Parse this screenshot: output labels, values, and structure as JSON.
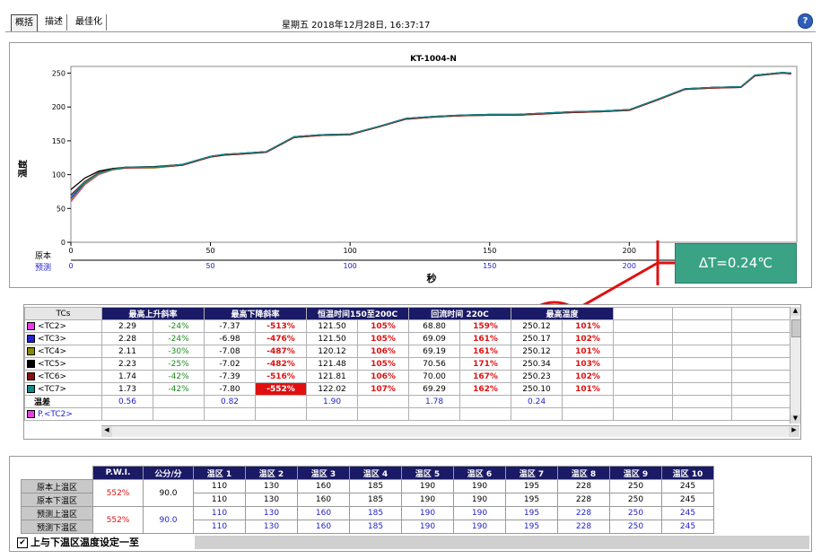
{
  "tabs": [
    {
      "label": "概括",
      "active": true
    },
    {
      "label": "描述",
      "active": false
    },
    {
      "label": "最佳化",
      "active": false
    }
  ],
  "datetime": "星期五 2018年12月28日, 16:37:17",
  "help_label": "?",
  "chart": {
    "title": "KT-1004-N",
    "ylabel": "温度",
    "xlabel": "秒",
    "row_labels": [
      "原本",
      "预测"
    ],
    "x_ticks": [
      "0",
      "50",
      "100",
      "150",
      "200"
    ],
    "y_ticks": [
      "0",
      "50",
      "100",
      "150",
      "200",
      "250"
    ],
    "delta_label": "ΔT=0.24℃"
  },
  "chart_data": {
    "type": "line",
    "title": "KT-1004-N",
    "xlabel": "秒",
    "ylabel": "温度",
    "xlim": [
      0,
      260
    ],
    "ylim": [
      0,
      260
    ],
    "series": [
      {
        "color": "#e83ce8",
        "x": [
          0,
          5,
          10,
          15,
          20,
          30,
          40,
          50,
          55,
          60,
          70,
          80,
          90,
          100,
          110,
          120,
          130,
          140,
          150,
          160,
          170,
          180,
          190,
          200,
          210,
          220,
          230,
          240,
          245,
          250,
          255,
          258
        ],
        "y": [
          60,
          85,
          100,
          107,
          110,
          110,
          114,
          126,
          129,
          130,
          133,
          155,
          158,
          159,
          170,
          182,
          185,
          187,
          188,
          188,
          190,
          192,
          193,
          195,
          210,
          226,
          228,
          229,
          246,
          248,
          250,
          249
        ]
      },
      {
        "color": "#2222cc",
        "x": [
          0,
          5,
          10,
          15,
          20,
          30,
          40,
          50,
          55,
          60,
          70,
          80,
          90,
          100,
          110,
          120,
          130,
          140,
          150,
          160,
          170,
          180,
          190,
          200,
          210,
          220,
          230,
          240,
          245,
          250,
          255,
          258
        ],
        "y": [
          65,
          88,
          102,
          108,
          111,
          111,
          115,
          127,
          130,
          131,
          134,
          156,
          159,
          160,
          171,
          183,
          186,
          188,
          189,
          189,
          191,
          193,
          194,
          196,
          211,
          227,
          229,
          230,
          247,
          249,
          251,
          250
        ]
      },
      {
        "color": "#8a8a00",
        "x": [
          0,
          5,
          10,
          15,
          20,
          30,
          40,
          50,
          55,
          60,
          70,
          80,
          90,
          100,
          110,
          120,
          130,
          140,
          150,
          160,
          170,
          180,
          190,
          200,
          210,
          220,
          230,
          240,
          245,
          250,
          255,
          258
        ],
        "y": [
          62,
          86,
          101,
          107,
          110,
          110,
          114,
          126,
          129,
          130,
          133,
          155,
          158,
          159,
          170,
          182,
          185,
          187,
          188,
          188,
          190,
          192,
          193,
          195,
          210,
          226,
          228,
          229,
          246,
          248,
          250,
          249
        ]
      },
      {
        "color": "#000000",
        "x": [
          0,
          5,
          10,
          15,
          20,
          30,
          40,
          50,
          55,
          60,
          70,
          80,
          90,
          100,
          110,
          120,
          130,
          140,
          150,
          160,
          170,
          180,
          190,
          200,
          210,
          220,
          230,
          240,
          245,
          250,
          255,
          258
        ],
        "y": [
          78,
          95,
          105,
          109,
          111,
          112,
          115,
          127,
          130,
          131,
          134,
          156,
          159,
          160,
          171,
          183,
          186,
          188,
          189,
          189,
          191,
          193,
          194,
          196,
          211,
          227,
          229,
          230,
          247,
          249,
          251,
          250
        ]
      },
      {
        "color": "#8a1010",
        "x": [
          0,
          5,
          10,
          15,
          20,
          30,
          40,
          50,
          55,
          60,
          70,
          80,
          90,
          100,
          110,
          120,
          130,
          140,
          150,
          160,
          170,
          180,
          190,
          200,
          210,
          220,
          230,
          240,
          245,
          250,
          255,
          258
        ],
        "y": [
          70,
          90,
          103,
          108,
          110,
          111,
          114,
          126,
          129,
          130,
          133,
          155,
          158,
          159,
          170,
          182,
          185,
          187,
          188,
          188,
          190,
          192,
          193,
          195,
          210,
          226,
          228,
          229,
          246,
          248,
          250,
          249
        ]
      },
      {
        "color": "#108a8a",
        "x": [
          0,
          5,
          10,
          15,
          20,
          30,
          40,
          50,
          55,
          60,
          70,
          80,
          90,
          100,
          110,
          120,
          130,
          140,
          150,
          160,
          170,
          180,
          190,
          200,
          210,
          220,
          230,
          240,
          245,
          250,
          255,
          258
        ],
        "y": [
          68,
          89,
          102,
          108,
          111,
          111,
          115,
          127,
          130,
          131,
          134,
          156,
          159,
          160,
          171,
          183,
          186,
          188,
          189,
          189,
          191,
          193,
          194,
          196,
          211,
          227,
          229,
          230,
          247,
          249,
          251,
          250
        ]
      }
    ]
  },
  "table": {
    "headers": [
      "TCs",
      "最高上升斜率",
      "最高下降斜率",
      "恒温时间150至200C",
      "回流时间 220C",
      "最高温度"
    ],
    "rows": [
      {
        "name": "<TC2>",
        "color": "#e83ce8",
        "cells": [
          "2.29",
          "-24%",
          "-7.37",
          "-513%",
          "121.50",
          "105%",
          "68.80",
          "159%",
          "250.12",
          "101%"
        ],
        "hi": [
          4
        ]
      },
      {
        "name": "<TC3>",
        "color": "#2222cc",
        "cells": [
          "2.28",
          "-24%",
          "-6.98",
          "-476%",
          "121.50",
          "105%",
          "69.09",
          "161%",
          "250.17",
          "102%"
        ],
        "hi": []
      },
      {
        "name": "<TC4>",
        "color": "#8a8a00",
        "cells": [
          "2.11",
          "-30%",
          "-7.08",
          "-487%",
          "120.12",
          "106%",
          "69.19",
          "161%",
          "250.12",
          "101%"
        ],
        "hi": []
      },
      {
        "name": "<TC5>",
        "color": "#000000",
        "cells": [
          "2.23",
          "-25%",
          "-7.02",
          "-482%",
          "121.48",
          "105%",
          "70.56",
          "171%",
          "250.34",
          "103%"
        ],
        "hi": []
      },
      {
        "name": "<TC6>",
        "color": "#8a1010",
        "cells": [
          "1.74",
          "-42%",
          "-7.39",
          "-516%",
          "121.81",
          "106%",
          "70.00",
          "167%",
          "250.23",
          "102%"
        ],
        "hi": []
      },
      {
        "name": "<TC7>",
        "color": "#108a8a",
        "cells": [
          "1.73",
          "-42%",
          "-7.80",
          "-552%",
          "122.02",
          "107%",
          "69.29",
          "162%",
          "250.10",
          "101%"
        ],
        "hi": [
          3
        ]
      }
    ],
    "diff_row": {
      "name": "温差",
      "values": [
        "0.56",
        "0.82",
        "1.90",
        "1.78",
        "0.24"
      ]
    },
    "predict_row": {
      "name": "P.<TC2>",
      "color": "#e83ce8"
    }
  },
  "bottom": {
    "headers": [
      "P.W.I.",
      "公分/分",
      "温区 1",
      "温区 2",
      "温区 3",
      "温区 4",
      "温区 5",
      "温区 6",
      "温区 7",
      "温区 8",
      "温区 9",
      "温区 10"
    ],
    "row_labels": [
      "原本上温区",
      "原本下温区",
      "预测上温区",
      "预测下温区"
    ],
    "pwi": [
      "552%",
      "552%"
    ],
    "speed": [
      "90.0",
      "90.0"
    ],
    "zones": [
      [
        "110",
        "130",
        "160",
        "185",
        "190",
        "190",
        "195",
        "228",
        "250",
        "245"
      ],
      [
        "110",
        "130",
        "160",
        "185",
        "190",
        "190",
        "195",
        "228",
        "250",
        "245"
      ],
      [
        "110",
        "130",
        "160",
        "185",
        "190",
        "190",
        "195",
        "228",
        "250",
        "245"
      ],
      [
        "110",
        "130",
        "160",
        "185",
        "190",
        "190",
        "195",
        "228",
        "250",
        "245"
      ]
    ],
    "checkbox_label": "上与下温区温度设定一至",
    "checkbox_checked": true
  }
}
